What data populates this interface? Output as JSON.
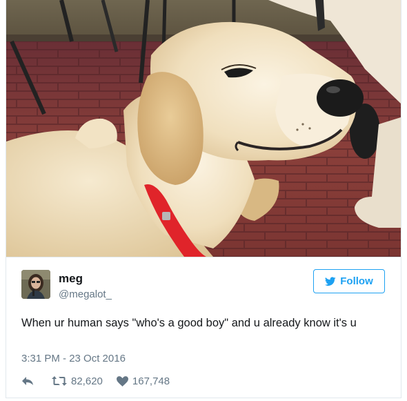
{
  "tweet": {
    "author_name": "meg",
    "author_handle": "@megalot_",
    "follow_label": "Follow",
    "text": "When ur human says \"who's a good boy\" and u already know it's u",
    "timestamp": "3:31 PM - 23 Oct 2016",
    "retweet_count": "82,620",
    "like_count": "167,748"
  },
  "photo": {
    "subject": "smiling golden retriever puppy with red collar on brick patio"
  },
  "colors": {
    "accent": "#1da1f2",
    "secondary_text": "#657786",
    "border": "#e1e8ed",
    "collar": "#e0242a"
  },
  "icons": {
    "follow": "twitter-bird-icon",
    "reply": "reply-icon",
    "retweet": "retweet-icon",
    "like": "heart-icon"
  }
}
